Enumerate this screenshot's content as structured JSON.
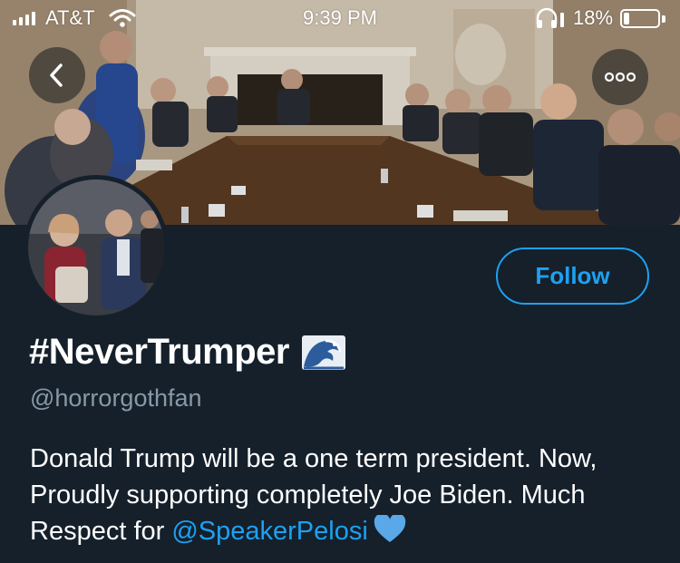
{
  "status_bar": {
    "carrier": "AT&T",
    "time": "9:39 PM",
    "battery_percent": "18%",
    "battery_level": 0.18,
    "signal_icon": "signal-bars-icon",
    "wifi_icon": "wifi-icon",
    "headphones_icon": "headphones-icon"
  },
  "nav": {
    "back_icon": "chevron-left-icon",
    "more_icon": "more-dots-icon"
  },
  "profile": {
    "follow_label": "Follow",
    "display_name": "#NeverTrumper",
    "name_emoji": "water-wave-icon",
    "handle": "@horrorgothfan",
    "bio_text": "Donald Trump will be a one term president. Now, Proudly supporting completely Joe Biden. Much Respect for ",
    "bio_mention": "@SpeakerPelosi",
    "bio_emoji": "blue-heart-icon"
  },
  "colors": {
    "background": "#15202b",
    "accent": "#1da1f2",
    "secondary_text": "#8899a6"
  }
}
